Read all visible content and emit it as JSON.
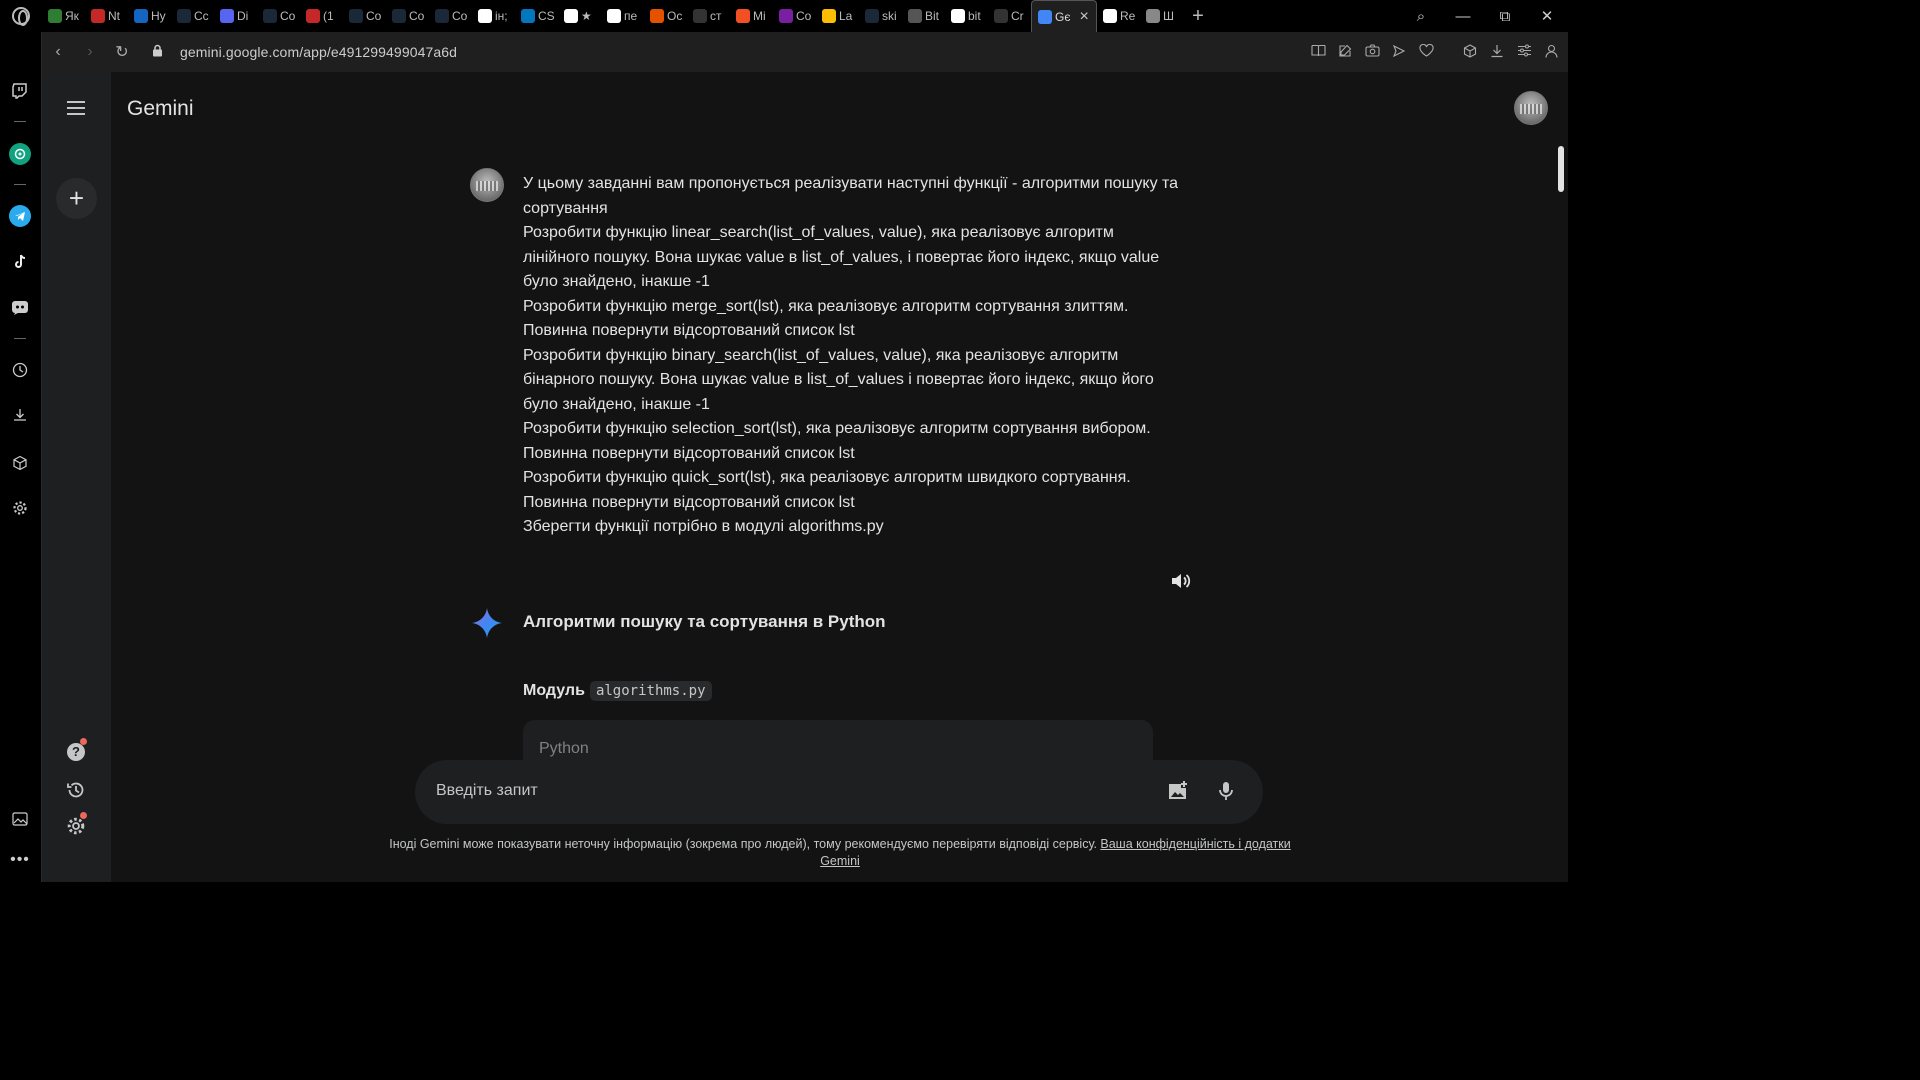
{
  "browser": {
    "tabs": [
      {
        "label": "Як",
        "icon": "store-icon",
        "color": "#2e7d32"
      },
      {
        "label": "Nt",
        "icon": "nt-icon",
        "color": "#c62828"
      },
      {
        "label": "Hy",
        "icon": "hy-icon",
        "color": "#1565c0"
      },
      {
        "label": "Cc",
        "icon": "steam-icon",
        "color": "#1b2838"
      },
      {
        "label": "Di",
        "icon": "discord-icon",
        "color": "#5865f2"
      },
      {
        "label": "Co",
        "icon": "steam-icon",
        "color": "#1b2838"
      },
      {
        "label": "(1",
        "icon": "1k-icon",
        "color": "#c62828"
      },
      {
        "label": "Co",
        "icon": "steam-icon",
        "color": "#1b2838"
      },
      {
        "label": "Co",
        "icon": "steam-icon",
        "color": "#1b2838"
      },
      {
        "label": "Co",
        "icon": "steam-icon",
        "color": "#1b2838"
      },
      {
        "label": "ін;",
        "icon": "google-icon",
        "color": "#ffffff"
      },
      {
        "label": "CS",
        "icon": "cs-icon",
        "color": "#0277bd"
      },
      {
        "label": "★",
        "icon": "google-icon",
        "color": "#ffffff"
      },
      {
        "label": "пе",
        "icon": "google-icon",
        "color": "#ffffff"
      },
      {
        "label": "Oc",
        "icon": "mo-icon",
        "color": "#e65100"
      },
      {
        "label": "ст",
        "icon": "chatgpt-icon",
        "color": "#333333"
      },
      {
        "label": "Mi",
        "icon": "microsoft-icon",
        "color": "#f25022"
      },
      {
        "label": "Co",
        "icon": "copilot-icon",
        "color": "#7b1fa2"
      },
      {
        "label": "La",
        "icon": "drive-icon",
        "color": "#fbbc04"
      },
      {
        "label": "ski",
        "icon": "steam-icon",
        "color": "#1b2838"
      },
      {
        "label": "Bit",
        "icon": "shield-icon",
        "color": "#555555"
      },
      {
        "label": "bit",
        "icon": "google-icon",
        "color": "#ffffff"
      },
      {
        "label": "Cr",
        "icon": "s-icon",
        "color": "#333333"
      },
      {
        "label": "Gє",
        "icon": "gemini-icon",
        "color": "#4285f4",
        "active": true
      },
      {
        "label": "Re",
        "icon": "github-icon",
        "color": "#ffffff"
      },
      {
        "label": "Ш",
        "icon": "grid-icon",
        "color": "#888888"
      }
    ],
    "url": "gemini.google.com/app/e491299499047a6d"
  },
  "app": {
    "title": "Gemini"
  },
  "prompt": {
    "lines": [
      "У цьому завданні вам пропонується реалізувати наступні функції - алгоритми пошуку та сортування",
      "Розробити функцію linear_search(list_of_values, value), яка реалізовує алгоритм лінійного пошуку. Вона шукає value в list_of_values, і повертає його індекс, якщо value було знайдено, інакше -1",
      "Розробити функцію merge_sort(lst), яка реалізовує алгоритм сортування злиттям. Повинна повернути відсортований список lst",
      "Розробити функцію binary_search(list_of_values, value), яка реалізовує алгоритм бінарного пошуку. Вона шукає value в list_of_values і повертає його індекс, якщо його було знайдено, інакше -1",
      "Розробити функцію selection_sort(lst), яка реалізовує алгоритм сортування вибором. Повинна повернути відсортований список lst",
      "Розробити функцію quick_sort(lst), яка реалізовує алгоритм швидкого сортування. Повинна повернути відсортований список lst",
      "Зберегти функції потрібно в модулі algorithms.py"
    ]
  },
  "response": {
    "title": "Алгоритми пошуку та сортування в Python",
    "module_label": "Модуль",
    "module_name": "algorithms.py",
    "code_language": "Python"
  },
  "input": {
    "placeholder": "Введіть запит"
  },
  "disclaimer": {
    "text": "Іноді Gemini може показувати неточну інформацію (зокрема про людей), тому рекомендуємо перевіряти відповіді сервісу. ",
    "link": "Ваша конфіденційність і додатки Gemini"
  }
}
